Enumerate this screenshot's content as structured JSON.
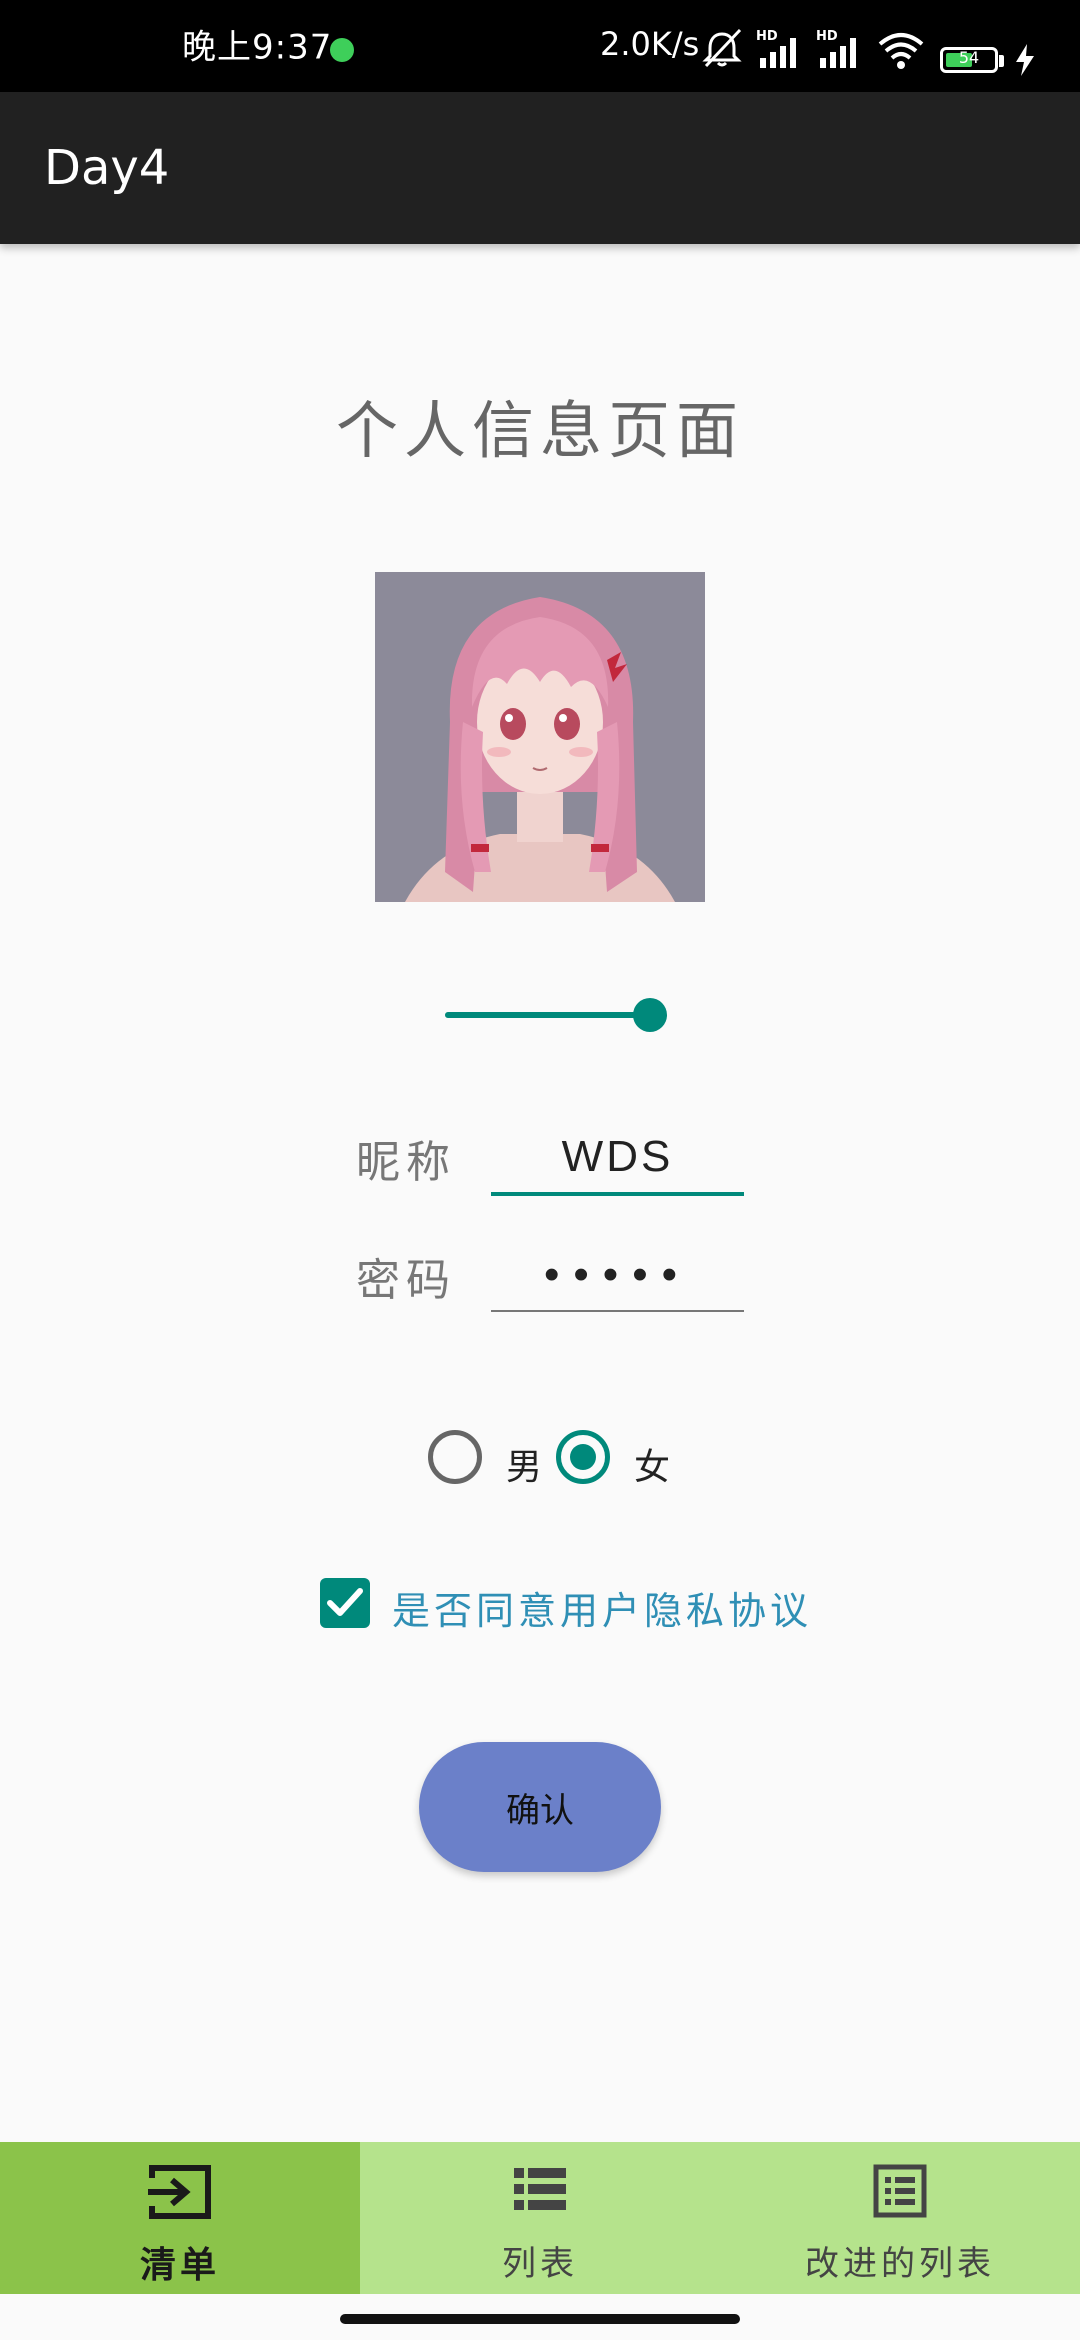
{
  "status_bar": {
    "time": "晚上9:37",
    "net_speed": "2.0K/s",
    "battery_level": "54",
    "icons": [
      "mute-icon",
      "hd-signal-icon",
      "hd-signal-icon",
      "wifi-icon",
      "battery-icon",
      "charging-icon"
    ]
  },
  "app_bar": {
    "title": "Day4"
  },
  "main": {
    "page_title": "个人信息页面",
    "slider_value": 1.0,
    "nickname": {
      "label": "昵称",
      "value": "WDS"
    },
    "password": {
      "label": "密码",
      "value": "•••••"
    },
    "gender": {
      "options": [
        {
          "label": "男",
          "checked": false
        },
        {
          "label": "女",
          "checked": true
        }
      ]
    },
    "agreement": {
      "label": "是否同意用户隐私协议",
      "checked": true
    },
    "confirm_label": "确认"
  },
  "bottom_nav": {
    "items": [
      {
        "label": "清单",
        "icon": "input-icon",
        "active": true
      },
      {
        "label": "列表",
        "icon": "list-icon",
        "active": false
      },
      {
        "label": "改进的列表",
        "icon": "list-box-icon",
        "active": false
      }
    ]
  },
  "colors": {
    "accent": "#00897b",
    "app_bar": "#212121",
    "nav_bg": "#b5e38c",
    "nav_active": "#8bc34a",
    "button": "#6b80c9",
    "link": "#2f8fb5"
  }
}
